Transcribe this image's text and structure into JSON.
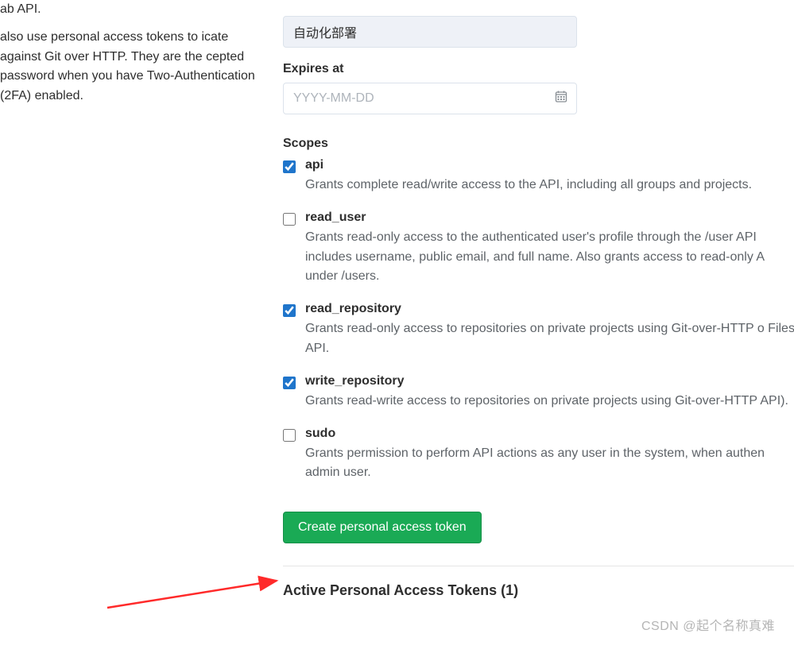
{
  "sidebar": {
    "p1": "ab API.",
    "p2": " also use personal access tokens to icate against Git over HTTP. They are the cepted password when you have Two-Authentication (2FA) enabled."
  },
  "form": {
    "name_value": "自动化部署",
    "expires_label": "Expires at",
    "expires_placeholder": "YYYY-MM-DD",
    "scopes_label": "Scopes"
  },
  "scopes": [
    {
      "name": "api",
      "checked": true,
      "desc": "Grants complete read/write access to the API, including all groups and projects."
    },
    {
      "name": "read_user",
      "checked": false,
      "desc": "Grants read-only access to the authenticated user's profile through the /user API includes username, public email, and full name. Also grants access to read-only A under /users."
    },
    {
      "name": "read_repository",
      "checked": true,
      "desc": "Grants read-only access to repositories on private projects using Git-over-HTTP o Files API."
    },
    {
      "name": "write_repository",
      "checked": true,
      "desc": "Grants read-write access to repositories on private projects using Git-over-HTTP API)."
    },
    {
      "name": "sudo",
      "checked": false,
      "desc": "Grants permission to perform API actions as any user in the system, when authen admin user."
    }
  ],
  "create_button": "Create personal access token",
  "active_tokens_title": "Active Personal Access Tokens (1)",
  "watermark": "CSDN @起个名称真难"
}
